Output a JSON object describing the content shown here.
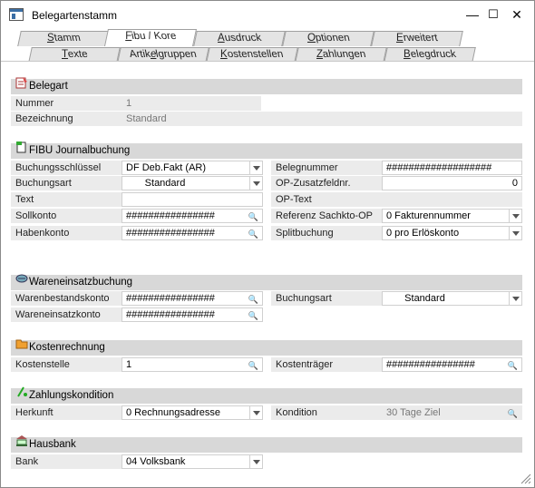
{
  "window": {
    "title": "Belegartenstamm",
    "min": "—",
    "max": "☐",
    "close": "✕"
  },
  "tabs_top": [
    {
      "label": "Stamm",
      "ul": "S",
      "rest": "tamm"
    },
    {
      "label": "Fibu / Kore",
      "ul": "F",
      "rest": "ibu / Kore"
    },
    {
      "label": "Ausdruck",
      "ul": "A",
      "rest": "usdruck"
    },
    {
      "label": "Optionen",
      "ul": "O",
      "rest": "ptionen"
    },
    {
      "label": "Erweitert",
      "ul": "E",
      "rest": "rweitert"
    }
  ],
  "tabs_sub": [
    {
      "label": "Texte",
      "pre": "",
      "ul": "T",
      "rest": "exte"
    },
    {
      "label": "Artikelgruppen",
      "pre": "Artik",
      "ul": "e",
      "rest": "lgruppen"
    },
    {
      "label": "Kostenstellen",
      "pre": "",
      "ul": "K",
      "rest": "ostenstellen"
    },
    {
      "label": "Zahlungen",
      "pre": "",
      "ul": "Z",
      "rest": "ahlungen"
    },
    {
      "label": "Belegdruck",
      "pre": "",
      "ul": "B",
      "rest": "elegdruck"
    }
  ],
  "belegart": {
    "header": "Belegart",
    "nummer_label": "Nummer",
    "nummer": "1",
    "bezeichnung_label": "Bezeichnung",
    "bezeichnung": "Standard"
  },
  "fibu": {
    "header": "FIBU Journalbuchung",
    "buchungsschluessel_label": "Buchungsschlüssel",
    "buchungsschluessel": "DF Deb.Fakt (AR)",
    "buchungsart_label": "Buchungsart",
    "buchungsart": "Standard",
    "text_label": "Text",
    "text": "",
    "sollkonto_label": "Sollkonto",
    "sollkonto": "################",
    "habenkonto_label": "Habenkonto",
    "habenkonto": "################",
    "belegnummer_label": "Belegnummer",
    "belegnummer": "###################",
    "op_zusatz_label": "OP-Zusatzfeldnr.",
    "op_zusatz": "0",
    "op_text_label": "OP-Text",
    "op_text": "",
    "referenz_label": "Referenz Sachkto-OP",
    "referenz": "0 Fakturennummer",
    "split_label": "Splitbuchung",
    "split": "0 pro Erlöskonto"
  },
  "waren": {
    "header": "Wareneinsatzbuchung",
    "bestand_label": "Warenbestandskonto",
    "bestand": "################",
    "einsatz_label": "Wareneinsatzkonto",
    "einsatz": "################",
    "buchungsart_label": "Buchungsart",
    "buchungsart": "Standard"
  },
  "kosten": {
    "header": "Kostenrechnung",
    "stelle_label": "Kostenstelle",
    "stelle": "1",
    "traeger_label": "Kostenträger",
    "traeger": "################"
  },
  "zahlung": {
    "header": "Zahlungskondition",
    "herkunft_label": "Herkunft",
    "herkunft": "0 Rechnungsadresse",
    "kondition_label": "Kondition",
    "kondition": "30 Tage Ziel"
  },
  "hausbank": {
    "header": "Hausbank",
    "bank_label": "Bank",
    "bank": "04  Volksbank"
  },
  "icons": {
    "search": "🔍"
  }
}
